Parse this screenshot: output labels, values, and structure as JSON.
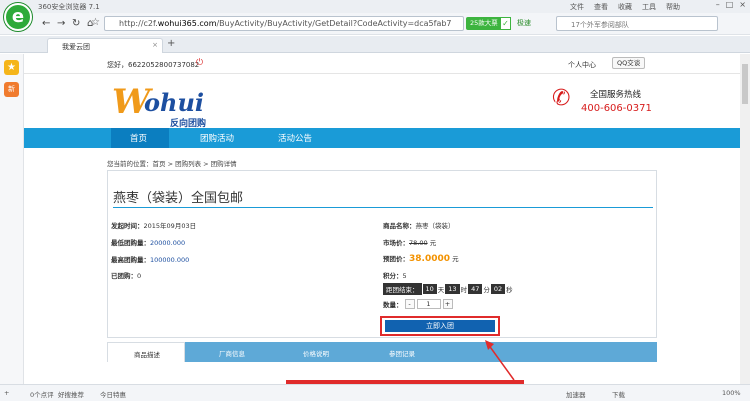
{
  "browser": {
    "app_title": "360安全浏览器 7.1",
    "menus": [
      "文件",
      "查看",
      "收藏",
      "工具",
      "帮助"
    ],
    "url_prefix": "http://c2f.",
    "url_host": "wohui365.com",
    "url_rest": "/BuyActivity/BuyActivity/GetDetail?CodeActivity=dca5fab7",
    "badge": "25款大票",
    "mode": "极速",
    "search_placeholder": "17个外军参阅部队",
    "tab_title": "我爱云团",
    "status": {
      "left": "0个点评",
      "bookmark": "好搜推荐",
      "today": "今日特惠",
      "accelerate": "加速器",
      "download": "下载",
      "zoom": "100%"
    }
  },
  "site": {
    "welcome": "您好，6622052800737082",
    "user_center": "个人中心",
    "qq": "QQ交谈",
    "brand_w": "W",
    "brand_rest": "ohui",
    "brand_sub": "反向团购",
    "hotline_title": "全国服务热线",
    "hotline_number": "400-606-0371",
    "nav": [
      "首页",
      "团购活动",
      "活动公告"
    ],
    "breadcrumb": "您当前的位置：首页 > 团购列表 > 团购详情"
  },
  "product": {
    "title": "燕枣（袋装）全国包邮",
    "start_label": "发起时间：",
    "start_value": "2015年09月03日",
    "min_label": "最低团购量：",
    "min_value": "20000.000",
    "max_label": "最高团购量：",
    "max_value": "100000.000",
    "joined_label": "已团购：",
    "joined_value": "0",
    "name_label": "商品名称：",
    "name_value": "燕枣（袋装）",
    "market_label": "市场价：",
    "market_value": "78.00",
    "market_unit": "元",
    "group_label": "预团价：",
    "group_value": "38.0000",
    "group_unit": "元",
    "points_label": "积分：",
    "points_value": "5",
    "countdown_label": "距团结束：",
    "cd_day": "10",
    "cd_day_u": "天",
    "cd_hour": "13",
    "cd_hour_u": "时",
    "cd_min": "47",
    "cd_min_u": "分",
    "cd_sec": "02",
    "cd_sec_u": "秒",
    "qty_label": "数量：",
    "qty_value": "1",
    "join_button": "立即入团",
    "tabs": [
      "商品描述",
      "厂商信息",
      "价格说明",
      "参团记录"
    ]
  }
}
